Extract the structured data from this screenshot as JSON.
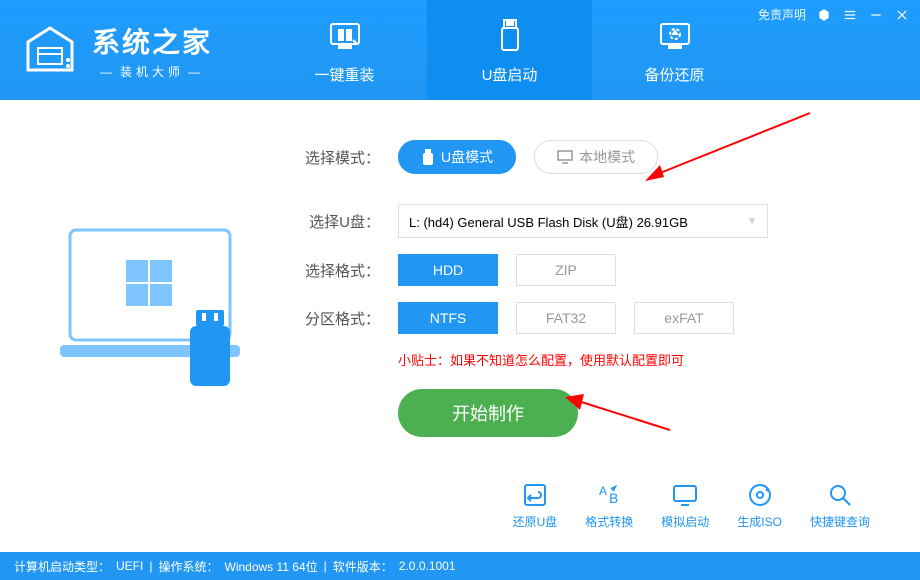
{
  "titlebar": {
    "disclaimer": "免责声明"
  },
  "logo": {
    "title": "系统之家",
    "subtitle": "装机大师"
  },
  "nav": {
    "reinstall": "一键重装",
    "usb": "U盘启动",
    "backup": "备份还原"
  },
  "labels": {
    "mode": "选择模式：",
    "udisk": "选择U盘：",
    "format": "选择格式：",
    "partition": "分区格式："
  },
  "mode": {
    "usb": "U盘模式",
    "local": "本地模式"
  },
  "udisk": {
    "value": "L: (hd4) General USB Flash Disk (U盘) 26.91GB"
  },
  "format": {
    "hdd": "HDD",
    "zip": "ZIP"
  },
  "partition": {
    "ntfs": "NTFS",
    "fat32": "FAT32",
    "exfat": "exFAT"
  },
  "hint": "小贴士：如果不知道怎么配置，使用默认配置即可",
  "start": "开始制作",
  "tools": {
    "restore": "还原U盘",
    "convert": "格式转换",
    "simulate": "模拟启动",
    "iso": "生成ISO",
    "hotkey": "快捷键查询"
  },
  "status": {
    "boot_label": "计算机启动类型：",
    "boot_value": "UEFI",
    "os_label": "操作系统：",
    "os_value": "Windows 11 64位",
    "ver_label": "软件版本：",
    "ver_value": "2.0.0.1001"
  }
}
